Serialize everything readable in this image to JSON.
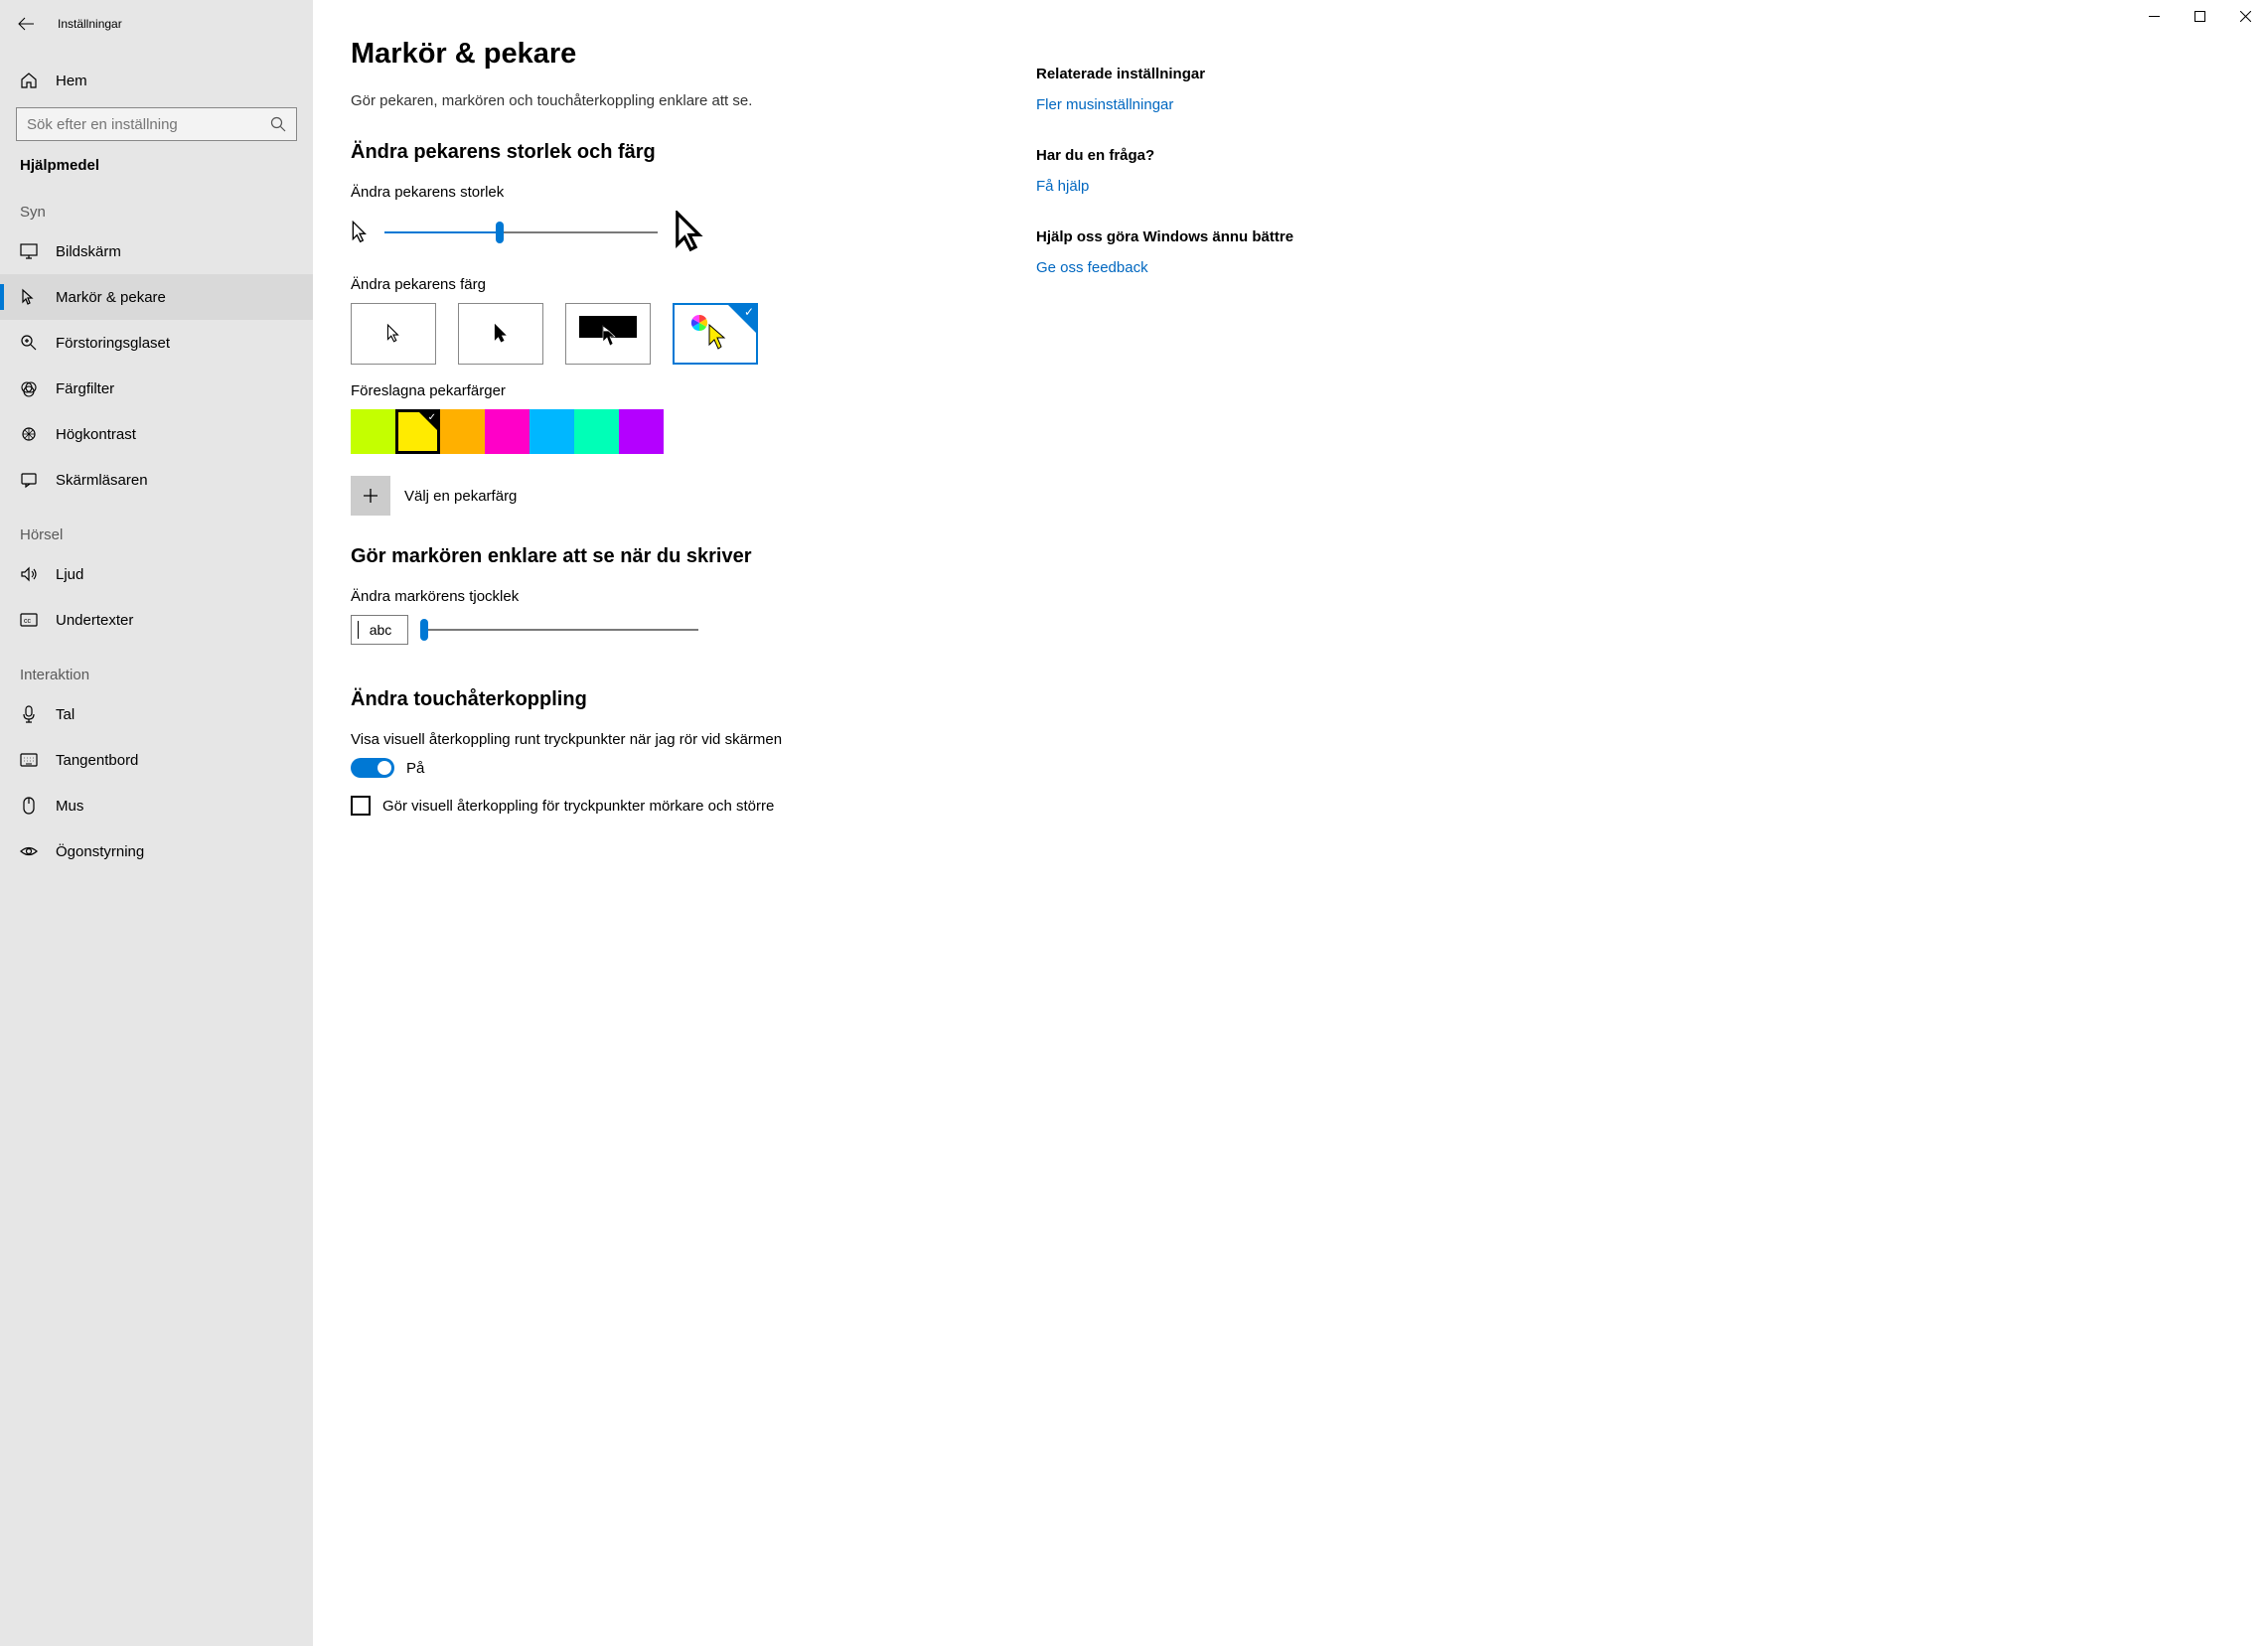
{
  "window": {
    "title": "Inställningar"
  },
  "sidebar": {
    "home": "Hem",
    "search_placeholder": "Sök efter en inställning",
    "category": "Hjälpmedel",
    "groups": [
      {
        "label": "Syn",
        "items": [
          {
            "key": "display",
            "label": "Bildskärm"
          },
          {
            "key": "cursor",
            "label": "Markör & pekare",
            "active": true
          },
          {
            "key": "magnifier",
            "label": "Förstoringsglaset"
          },
          {
            "key": "colorfilter",
            "label": "Färgfilter"
          },
          {
            "key": "highcontrast",
            "label": "Högkontrast"
          },
          {
            "key": "narrator",
            "label": "Skärmläsaren"
          }
        ]
      },
      {
        "label": "Hörsel",
        "items": [
          {
            "key": "audio",
            "label": "Ljud"
          },
          {
            "key": "captions",
            "label": "Undertexter"
          }
        ]
      },
      {
        "label": "Interaktion",
        "items": [
          {
            "key": "speech",
            "label": "Tal"
          },
          {
            "key": "keyboard",
            "label": "Tangentbord"
          },
          {
            "key": "mouse",
            "label": "Mus"
          },
          {
            "key": "eye",
            "label": "Ögonstyrning"
          }
        ]
      }
    ]
  },
  "main": {
    "title": "Markör & pekare",
    "subtitle": "Gör pekaren, markören och touchåterkoppling enklare att se.",
    "section_size": {
      "heading": "Ändra pekarens storlek och färg",
      "size_label": "Ändra pekarens storlek",
      "size_percent": 42,
      "color_label": "Ändra pekarens färg",
      "suggested_label": "Föreslagna pekarfärger",
      "suggested_colors": [
        "#c4ff00",
        "#ffeb00",
        "#ffb000",
        "#ff00c8",
        "#00b7ff",
        "#00ffb7",
        "#b400ff"
      ],
      "selected_swatch_index": 1,
      "custom_label": "Välj en pekarfärg"
    },
    "section_thickness": {
      "heading": "Gör markören enklare att se när du skriver",
      "label": "Ändra markörens tjocklek",
      "preview": "abc"
    },
    "section_touch": {
      "heading": "Ändra touchåterkoppling",
      "toggle_label": "Visa visuell återkoppling runt tryckpunkter när jag rör vid skärmen",
      "toggle_state": "På",
      "checkbox_label": "Gör visuell återkoppling för tryckpunkter mörkare och större"
    }
  },
  "right": {
    "related_title": "Relaterade inställningar",
    "related_link": "Fler musinställningar",
    "question_title": "Har du en fråga?",
    "question_link": "Få hjälp",
    "improve_title": "Hjälp oss göra Windows ännu bättre",
    "improve_link": "Ge oss feedback"
  }
}
